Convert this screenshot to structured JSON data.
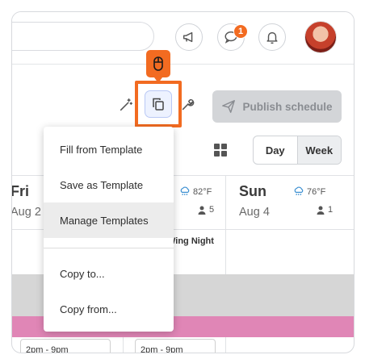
{
  "header": {
    "notification_count": "1",
    "icons": [
      "megaphone-icon",
      "chat-icon",
      "bell-icon"
    ]
  },
  "toolbar": {
    "publish_label": "Publish schedule",
    "view_toggle": {
      "day": "Day",
      "week": "Week",
      "selected": "Week"
    }
  },
  "copy_menu": {
    "items": [
      {
        "label": "Fill from Template"
      },
      {
        "label": "Save as Template"
      },
      {
        "label": "Manage Templates",
        "highlighted": true
      },
      {
        "label": "Copy to..."
      },
      {
        "label": "Copy from..."
      }
    ]
  },
  "calendar": {
    "days": [
      {
        "day": "Fri",
        "date": "Aug 2"
      },
      {
        "day": "",
        "date": "",
        "temp": "82°F",
        "people": "5"
      },
      {
        "day": "Sun",
        "date": "Aug 4",
        "temp": "76°F",
        "people": "1"
      }
    ],
    "event_text": "Wing Night",
    "shifts": [
      "2pm - 9pm",
      "2pm - 9pm"
    ]
  },
  "colors": {
    "accent": "#f26b21",
    "pink_band": "#e086b6",
    "gray_band": "#d6d6d6",
    "publish_bg": "#d3d5d8"
  }
}
